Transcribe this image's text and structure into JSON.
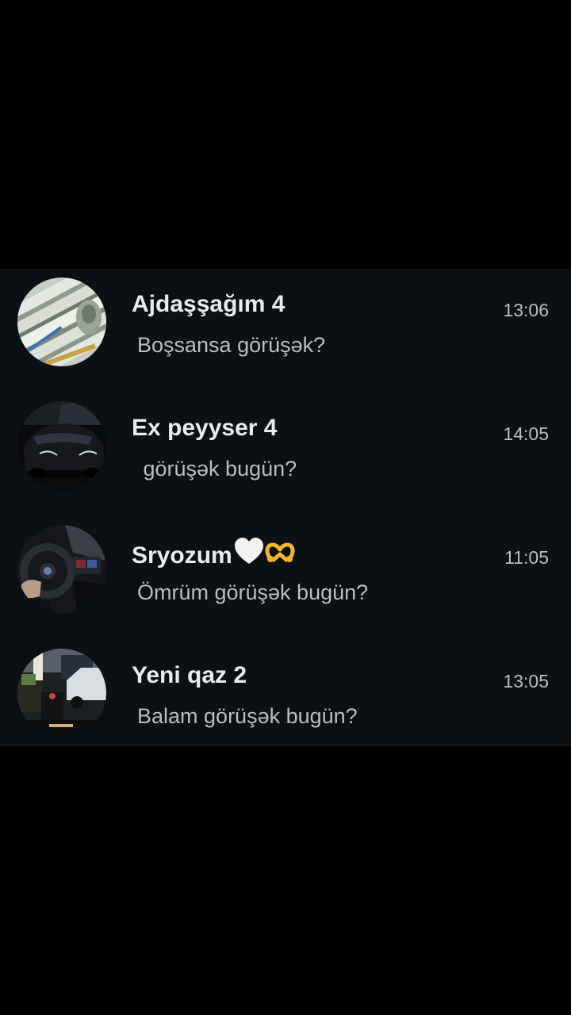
{
  "chat_list": {
    "items": [
      {
        "name": "Ajdaşşağım 4",
        "message": "Boşsansa görüşək?",
        "time": "13:06",
        "avatar_icon": "money-stack-avatar"
      },
      {
        "name": "Ex peyyser 4",
        "message": " görüşək bugün?",
        "time": "14:05",
        "avatar_icon": "black-car-avatar"
      },
      {
        "name": "Sryozum",
        "name_emojis": [
          "white-heart-icon",
          "heart-hands-icon"
        ],
        "message": "Ömrüm görüşək bugün?",
        "time": "11:05",
        "avatar_icon": "car-interior-avatar"
      },
      {
        "name": "Yeni qaz 2",
        "message": "Balam görüşək bugün?",
        "time": "13:05",
        "avatar_icon": "street-night-avatar"
      }
    ]
  },
  "colors": {
    "background": "#000000",
    "panel": "#0c0f13",
    "name_text": "#e9ecef",
    "secondary_text": "#b8bec4"
  }
}
